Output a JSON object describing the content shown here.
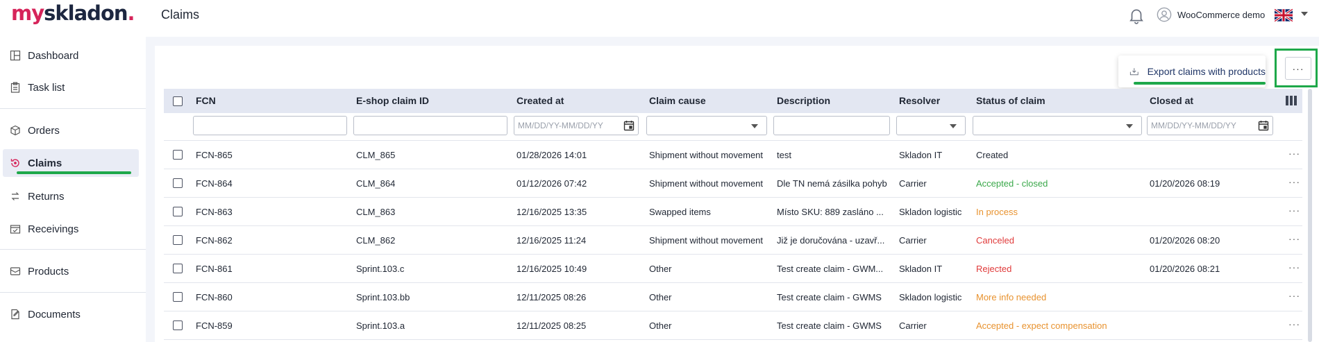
{
  "brand": {
    "my": "my",
    "name": "skladon",
    "dot": "."
  },
  "header": {
    "title": "Claims",
    "user_name": "WooCommerce demo",
    "language_flag": "uk-flag-icon"
  },
  "sidebar": {
    "items": [
      {
        "label": "Dashboard",
        "icon": "dashboard-icon"
      },
      {
        "label": "Task list",
        "icon": "clipboard-icon"
      },
      {
        "label": "Orders",
        "icon": "box-icon"
      },
      {
        "label": "Claims",
        "icon": "claims-icon",
        "active": true
      },
      {
        "label": "Returns",
        "icon": "returns-icon"
      },
      {
        "label": "Receivings",
        "icon": "receivings-icon"
      },
      {
        "label": "Products",
        "icon": "products-icon"
      },
      {
        "label": "Documents",
        "icon": "documents-icon"
      }
    ]
  },
  "toolbar": {
    "export_label": "Export claims with products",
    "more_label": "···"
  },
  "table": {
    "columns": [
      "FCN",
      "E-shop claim ID",
      "Created at",
      "Claim cause",
      "Description",
      "Resolver",
      "Status of claim",
      "Closed at"
    ],
    "date_placeholder": "MM/DD/YY-MM/DD/YY",
    "row_more": "···",
    "rows": [
      {
        "fcn": "FCN-865",
        "eshop": "CLM_865",
        "created": "01/28/2026 14:01",
        "cause": "Shipment without movement",
        "desc": "test",
        "resolver": "Skladon IT",
        "status": "Created",
        "closed": ""
      },
      {
        "fcn": "FCN-864",
        "eshop": "CLM_864",
        "created": "01/12/2026 07:42",
        "cause": "Shipment without movement",
        "desc": "Dle TN nemá zásilka pohyb",
        "resolver": "Carrier",
        "status": "Accepted - closed",
        "closed": "01/20/2026 08:19"
      },
      {
        "fcn": "FCN-863",
        "eshop": "CLM_863",
        "created": "12/16/2025 13:35",
        "cause": "Swapped items",
        "desc": "Místo SKU: 889 zasláno ...",
        "resolver": "Skladon logistic",
        "status": "In process",
        "closed": ""
      },
      {
        "fcn": "FCN-862",
        "eshop": "CLM_862",
        "created": "12/16/2025 11:24",
        "cause": "Shipment without movement",
        "desc": "Již je doručována - uzavř...",
        "resolver": "Carrier",
        "status": "Canceled",
        "closed": "01/20/2026 08:20"
      },
      {
        "fcn": "FCN-861",
        "eshop": "Sprint.103.c",
        "created": "12/16/2025 10:49",
        "cause": "Other",
        "desc": "Test create claim - GWM...",
        "resolver": "Skladon IT",
        "status": "Rejected",
        "closed": "01/20/2026 08:21"
      },
      {
        "fcn": "FCN-860",
        "eshop": "Sprint.103.bb",
        "created": "12/11/2025 08:26",
        "cause": "Other",
        "desc": "Test create claim - GWMS",
        "resolver": "Skladon logistic",
        "status": "More info needed",
        "closed": ""
      },
      {
        "fcn": "FCN-859",
        "eshop": "Sprint.103.a",
        "created": "12/11/2025 08:25",
        "cause": "Other",
        "desc": "Test create claim - GWMS",
        "resolver": "Carrier",
        "status": "Accepted - expect compensation",
        "closed": ""
      }
    ]
  },
  "colors": {
    "brand_pink": "#d6245a",
    "highlight_green": "#1ea84a",
    "status_accepted_closed": "#3aa84a",
    "status_in_process": "#e8922e",
    "status_canceled": "#e03a3a",
    "status_rejected": "#e03a3a",
    "status_more_info": "#e8922e",
    "status_accepted_expect": "#e8922e",
    "status_created": "#1f2633"
  }
}
